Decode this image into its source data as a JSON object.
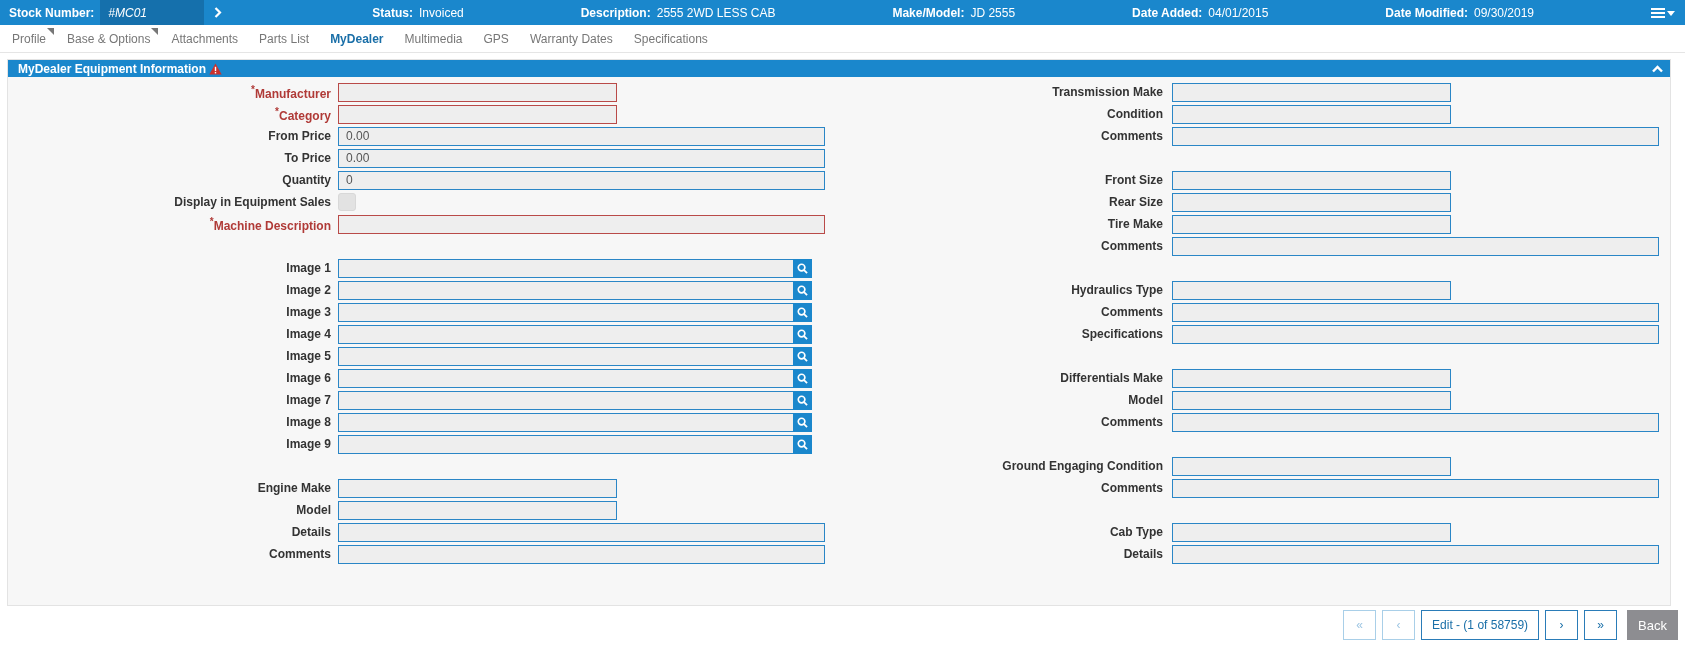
{
  "header": {
    "stock": {
      "label": "Stock Number:",
      "value": "#MC01"
    },
    "items": [
      {
        "label": "Status:",
        "value": "Invoiced"
      },
      {
        "label": "Description:",
        "value": "2555 2WD LESS CAB"
      },
      {
        "label": "Make/Model:",
        "value": "JD 2555"
      },
      {
        "label": "Date Added:",
        "value": "04/01/2015"
      },
      {
        "label": "Date Modified:",
        "value": "09/30/2019"
      }
    ]
  },
  "tabs": [
    {
      "label": "Profile",
      "selected": false,
      "flagged": true
    },
    {
      "label": "Base & Options",
      "selected": false,
      "flagged": true
    },
    {
      "label": "Attachments",
      "selected": false,
      "flagged": false
    },
    {
      "label": "Parts List",
      "selected": false,
      "flagged": false
    },
    {
      "label": "MyDealer",
      "selected": true,
      "flagged": false
    },
    {
      "label": "Multimedia",
      "selected": false,
      "flagged": false
    },
    {
      "label": "GPS",
      "selected": false,
      "flagged": false
    },
    {
      "label": "Warranty Dates",
      "selected": false,
      "flagged": false
    },
    {
      "label": "Specifications",
      "selected": false,
      "flagged": false
    }
  ],
  "panel": {
    "title": "MyDealer Equipment Information",
    "warning": true,
    "expanded": true
  },
  "form": {
    "left": [
      {
        "kind": "text",
        "label": "$^{*}$Manufacturer",
        "required": true,
        "wide": false
      },
      {
        "kind": "text",
        "label": "$^{*}$Category",
        "required": true,
        "wide": false
      },
      {
        "kind": "text",
        "label": "From Price",
        "required": false,
        "wide": true,
        "value": "0.00"
      },
      {
        "kind": "text",
        "label": "To Price",
        "required": false,
        "wide": true,
        "value": "0.00"
      },
      {
        "kind": "text",
        "label": "Quantity",
        "required": false,
        "wide": true,
        "value": "0"
      },
      {
        "kind": "checkbox",
        "label": "Display in Equipment Sales",
        "checked": false,
        "disabled": true
      },
      {
        "kind": "text",
        "label": "$^{*}$Machine Description",
        "required": true,
        "wide": true
      },
      {
        "kind": "spacer"
      },
      {
        "kind": "image",
        "label": "Image 1"
      },
      {
        "kind": "image",
        "label": "Image 2"
      },
      {
        "kind": "image",
        "label": "Image 3"
      },
      {
        "kind": "image",
        "label": "Image 4"
      },
      {
        "kind": "image",
        "label": "Image 5"
      },
      {
        "kind": "image",
        "label": "Image 6"
      },
      {
        "kind": "image",
        "label": "Image 7"
      },
      {
        "kind": "image",
        "label": "Image 8"
      },
      {
        "kind": "image",
        "label": "Image 9"
      },
      {
        "kind": "spacer"
      },
      {
        "kind": "text",
        "label": "Engine Make",
        "required": false,
        "wide": false
      },
      {
        "kind": "text",
        "label": "Model",
        "required": false,
        "wide": false
      },
      {
        "kind": "text",
        "label": "Details",
        "required": false,
        "wide": true
      },
      {
        "kind": "text",
        "label": "Comments",
        "required": false,
        "wide": true
      }
    ],
    "right": [
      {
        "kind": "text",
        "label": "Transmission Make",
        "required": false,
        "wide": false
      },
      {
        "kind": "text",
        "label": "Condition",
        "required": false,
        "wide": false
      },
      {
        "kind": "text",
        "label": "Comments",
        "required": false,
        "wide": true
      },
      {
        "kind": "spacer"
      },
      {
        "kind": "text",
        "label": "Front Size",
        "required": false,
        "wide": false
      },
      {
        "kind": "text",
        "label": "Rear Size",
        "required": false,
        "wide": false
      },
      {
        "kind": "text",
        "label": "Tire Make",
        "required": false,
        "wide": false
      },
      {
        "kind": "text",
        "label": "Comments",
        "required": false,
        "wide": true
      },
      {
        "kind": "spacer"
      },
      {
        "kind": "text",
        "label": "Hydraulics Type",
        "required": false,
        "wide": false
      },
      {
        "kind": "text",
        "label": "Comments",
        "required": false,
        "wide": true
      },
      {
        "kind": "text",
        "label": "Specifications",
        "required": false,
        "wide": true
      },
      {
        "kind": "spacer"
      },
      {
        "kind": "text",
        "label": "Differentials Make",
        "required": false,
        "wide": false
      },
      {
        "kind": "text",
        "label": "Model",
        "required": false,
        "wide": false
      },
      {
        "kind": "text",
        "label": "Comments",
        "required": false,
        "wide": true
      },
      {
        "kind": "spacer"
      },
      {
        "kind": "text",
        "label": "Ground Engaging Condition",
        "required": false,
        "wide": false
      },
      {
        "kind": "text",
        "label": "Comments",
        "required": false,
        "wide": true
      },
      {
        "kind": "spacer"
      },
      {
        "kind": "text",
        "label": "Cab Type",
        "required": false,
        "wide": false
      },
      {
        "kind": "text",
        "label": "Details",
        "required": false,
        "wide": true
      }
    ]
  },
  "pager": [
    {
      "kind": "nav",
      "label": "«",
      "disabled": true
    },
    {
      "kind": "nav",
      "label": "‹",
      "disabled": true
    },
    {
      "kind": "nav",
      "label": "Edit - (1 of 58759)",
      "disabled": false
    },
    {
      "kind": "nav",
      "label": "›",
      "disabled": false
    },
    {
      "kind": "nav",
      "label": "»",
      "disabled": false
    },
    {
      "kind": "back",
      "label": "Back",
      "disabled": false
    }
  ]
}
